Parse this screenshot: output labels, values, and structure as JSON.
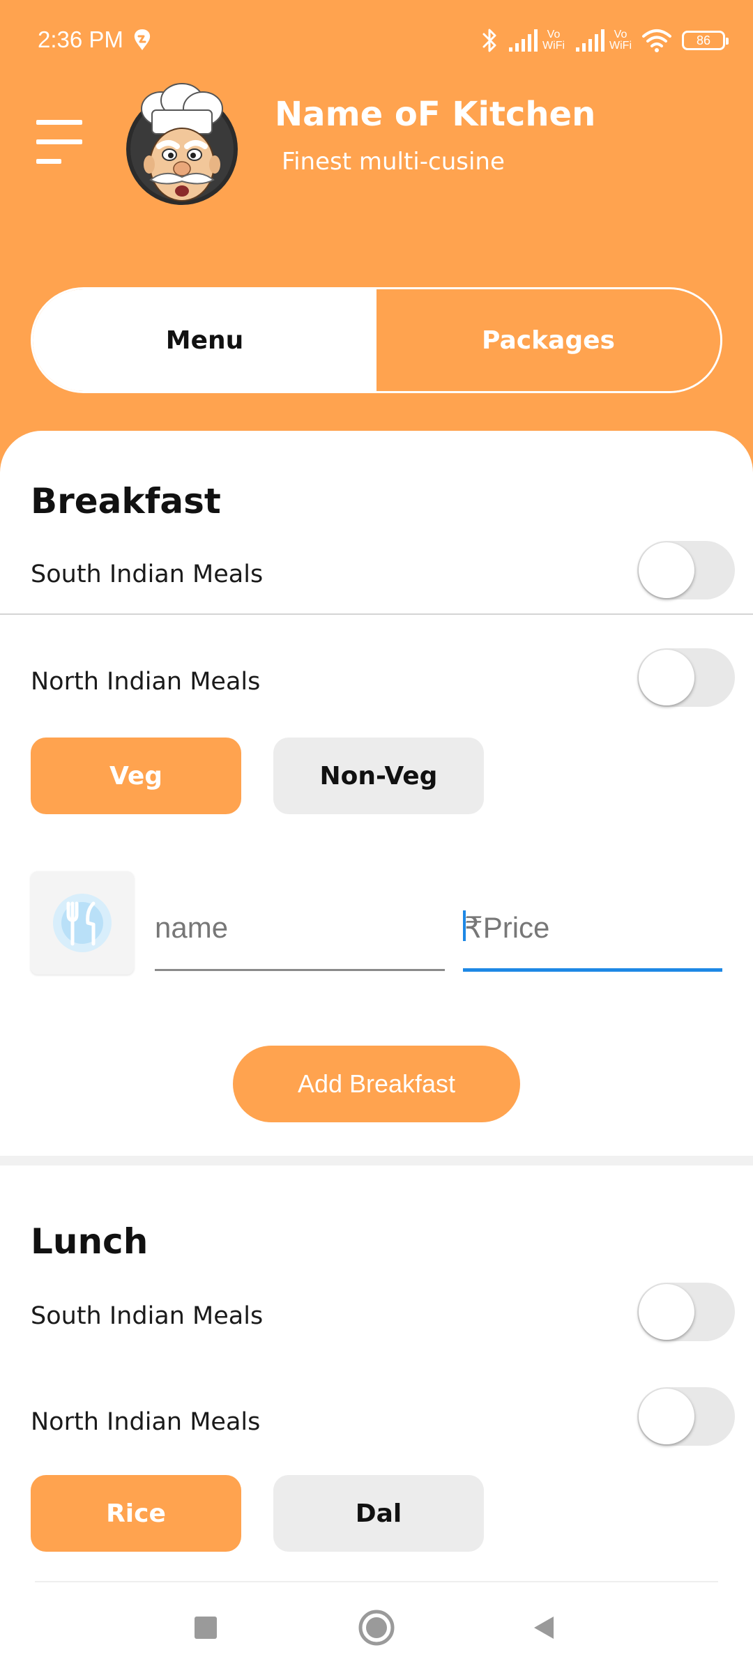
{
  "status_bar": {
    "time": "2:36 PM",
    "sim1_label": "Vo\nWiFi",
    "sim2_label": "Vo\nWiFi",
    "battery": "86",
    "icons": [
      "app-notification-icon",
      "bluetooth-icon",
      "signal-icon",
      "signal-icon",
      "wifi-icon",
      "battery-icon"
    ]
  },
  "header": {
    "kitchen_name": "Name oF Kitchen",
    "tagline": "Finest multi-cusine",
    "menu_icon": "hamburger-menu-icon",
    "avatar": "chef-avatar"
  },
  "tabs": [
    {
      "label": "Menu",
      "active": true
    },
    {
      "label": "Packages",
      "active": false
    }
  ],
  "breakfast": {
    "title": "Breakfast",
    "south_label": "South Indian Meals",
    "north_label": "North Indian Meals",
    "south_enabled": false,
    "north_enabled": false,
    "chips": [
      {
        "label": "Veg",
        "selected": true
      },
      {
        "label": "Non-Veg",
        "selected": false
      }
    ],
    "name_placeholder": "name",
    "price_placeholder": "₹Price",
    "add_label": "Add Breakfast"
  },
  "lunch": {
    "title": "Lunch",
    "south_label": "South Indian Meals",
    "north_label": "North Indian Meals",
    "south_enabled": false,
    "north_enabled": false,
    "chips": [
      {
        "label": "Rice",
        "selected": true
      },
      {
        "label": "Dal",
        "selected": false
      }
    ]
  },
  "nav": {
    "recents": "recents-square-icon",
    "home": "home-circle-icon",
    "back": "back-triangle-icon"
  },
  "colors": {
    "accent": "#FFA34F",
    "focus_line": "#1E88E5",
    "chip_inactive": "#ECECEC",
    "toggle_track": "#E8E8E8"
  }
}
